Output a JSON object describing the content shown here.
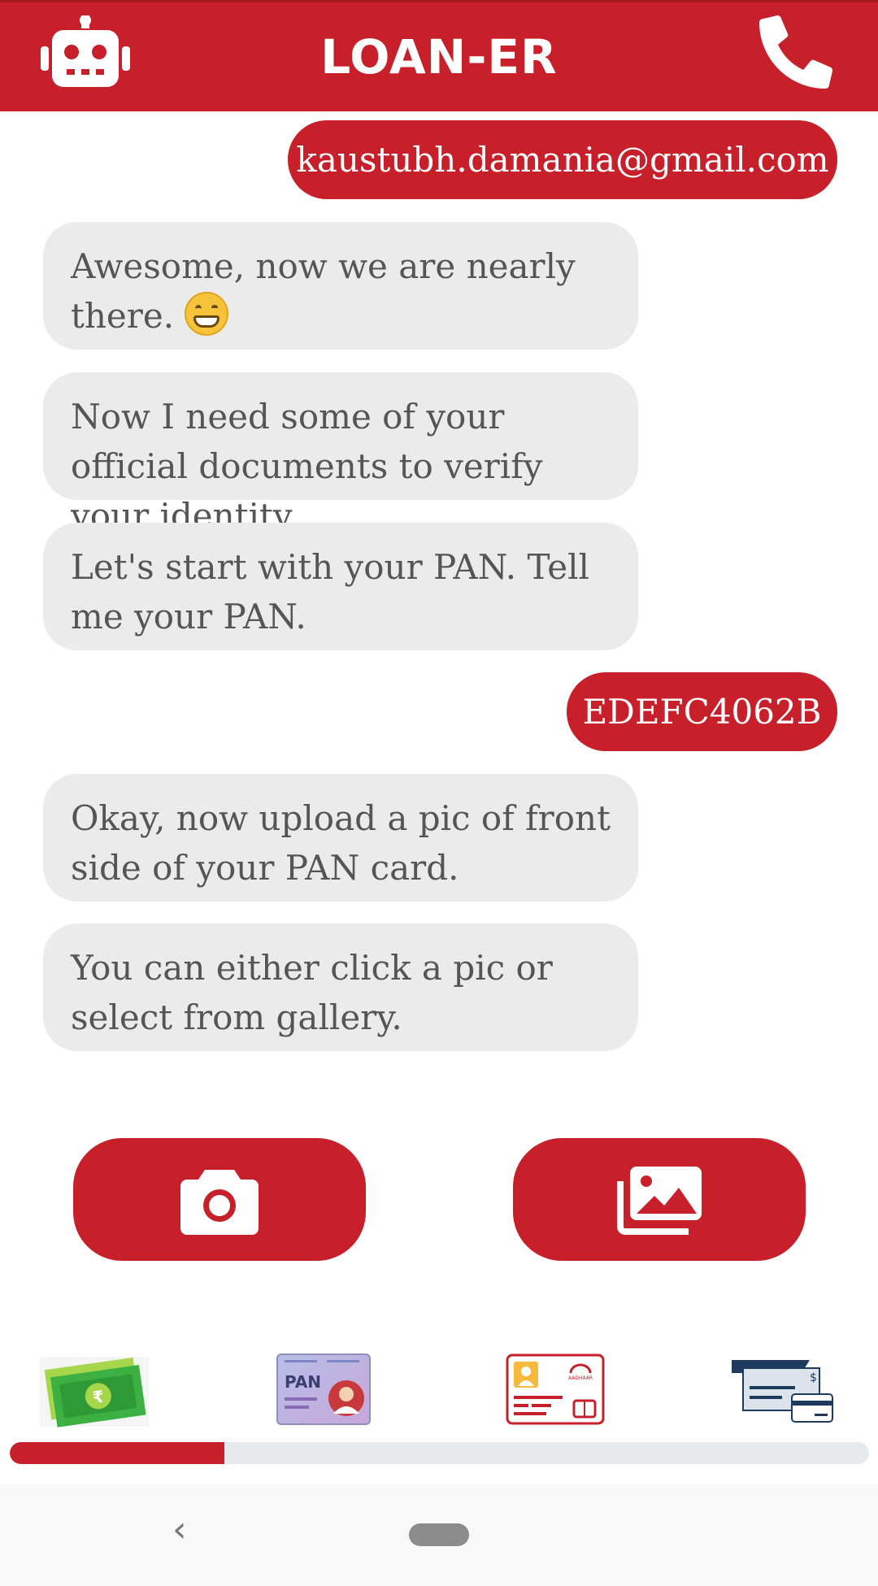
{
  "app": {
    "title": "LOAN-ER"
  },
  "header": {
    "left_icon": "robot-icon",
    "right_icon": "phone-icon"
  },
  "messages": [
    {
      "from": "user",
      "text": "kaustubh.damania@gmail.com"
    },
    {
      "from": "bot",
      "text": "Awesome, now we are nearly there.",
      "emoji": "grinning-face"
    },
    {
      "from": "bot",
      "text": "Now I need some of your official documents to verify your identity"
    },
    {
      "from": "bot",
      "text": "Let's start with your PAN. Tell me your PAN."
    },
    {
      "from": "user",
      "text": "EDEFC4062B"
    },
    {
      "from": "bot",
      "text": "Okay, now upload a pic of front side of your PAN card."
    },
    {
      "from": "bot",
      "text": "You can either click a pic or select from gallery."
    }
  ],
  "actions": [
    {
      "icon": "camera-icon"
    },
    {
      "icon": "gallery-icon"
    }
  ],
  "documents": [
    {
      "icon": "money-icon",
      "label": "₹"
    },
    {
      "icon": "pan-card-icon",
      "label": "PAN"
    },
    {
      "icon": "aadhaar-card-icon",
      "label": "AADHAAR"
    },
    {
      "icon": "bank-cheque-icon",
      "label": "$"
    }
  ],
  "progress": {
    "fraction": 0.25
  },
  "colors": {
    "brand": "#c8202a",
    "bubble": "#ebebeb",
    "text": "#555555"
  }
}
